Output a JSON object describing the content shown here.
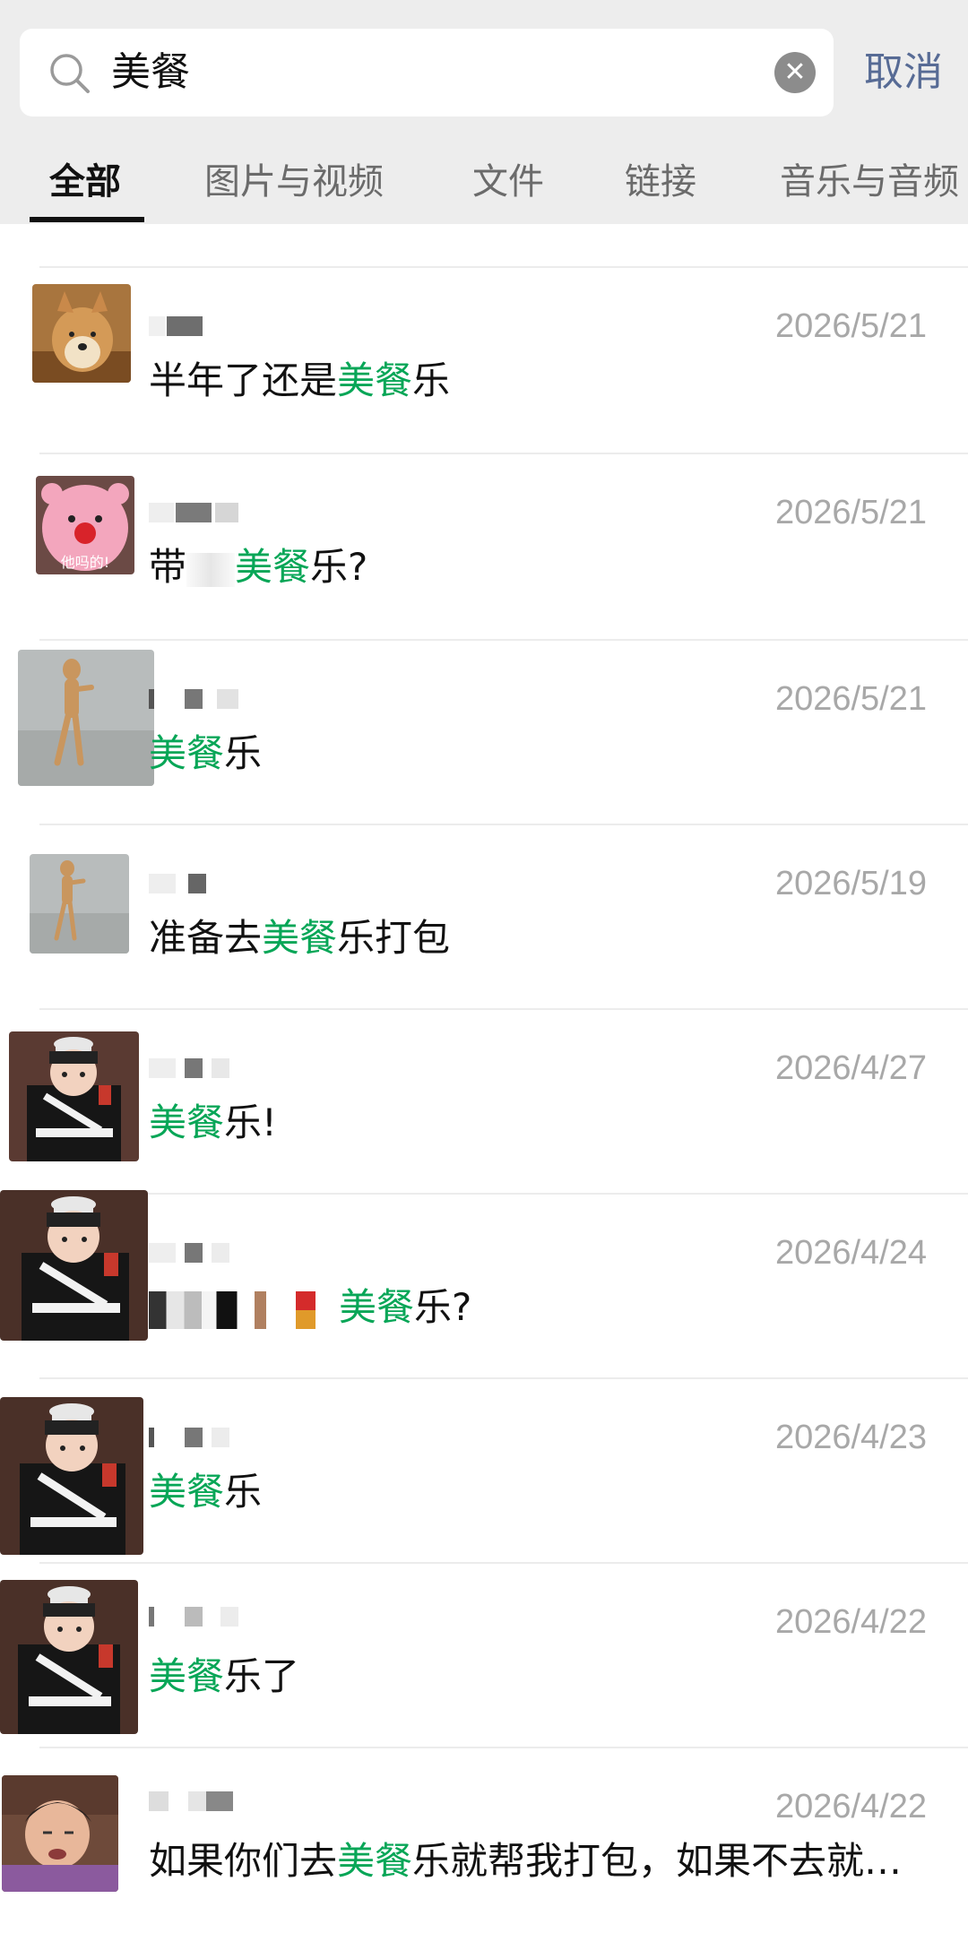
{
  "search": {
    "query": "美餐",
    "cancel_label": "取消"
  },
  "tabs": [
    {
      "label": "全部",
      "active": true
    },
    {
      "label": "图片与视频",
      "active": false
    },
    {
      "label": "文件",
      "active": false
    },
    {
      "label": "链接",
      "active": false
    },
    {
      "label": "音乐与音频",
      "active": false
    }
  ],
  "results": [
    {
      "date": "2026/5/21",
      "pre": "半年了还是",
      "hl": "美餐",
      "post": "乐"
    },
    {
      "date": "2026/5/21",
      "pre": "带",
      "hl": "美餐",
      "post": "乐?"
    },
    {
      "date": "2026/5/21",
      "pre": "",
      "hl": "美餐",
      "post": "乐"
    },
    {
      "date": "2026/5/19",
      "pre": "准备去",
      "hl": "美餐",
      "post": "乐打包"
    },
    {
      "date": "2026/4/27",
      "pre": "",
      "hl": "美餐",
      "post": "乐!"
    },
    {
      "date": "2026/4/24",
      "pre": "",
      "hl": "美餐",
      "post": "乐?"
    },
    {
      "date": "2026/4/23",
      "pre": "",
      "hl": "美餐",
      "post": "乐"
    },
    {
      "date": "2026/4/22",
      "pre": "",
      "hl": "美餐",
      "post": "乐了"
    },
    {
      "date": "2026/4/22",
      "pre": "如果你们去",
      "hl": "美餐",
      "post": "乐就帮我打包，如果不去就…"
    }
  ],
  "avatar_caption": "他吗的!",
  "colors": {
    "highlight": "#07a657",
    "cancel": "#576b95",
    "header_bg": "#ededed",
    "date": "#a8a8a8"
  }
}
